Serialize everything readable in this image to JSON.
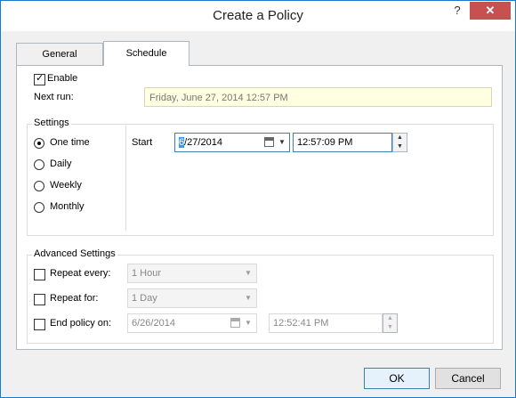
{
  "window": {
    "title": "Create a Policy",
    "help_glyph": "?",
    "close_glyph": "✕"
  },
  "tabs": [
    {
      "label": "General",
      "active": false
    },
    {
      "label": "Schedule",
      "active": true
    }
  ],
  "schedule": {
    "enable_label": "Enable",
    "enable_checked": true,
    "next_run_label": "Next run:",
    "next_run_value": "Friday, June 27, 2014 12:57 PM"
  },
  "settings": {
    "group_label": "Settings",
    "options": [
      {
        "label": "One time",
        "selected": true
      },
      {
        "label": "Daily",
        "selected": false
      },
      {
        "label": "Weekly",
        "selected": false
      },
      {
        "label": "Monthly",
        "selected": false
      }
    ],
    "start_label": "Start",
    "start_date_selected": "6",
    "start_date_rest": "/27/2014",
    "start_time": "12:57:09 PM"
  },
  "advanced": {
    "group_label": "Advanced Settings",
    "repeat_every_label": "Repeat every:",
    "repeat_every_value": "1 Hour",
    "repeat_for_label": "Repeat for:",
    "repeat_for_value": "1 Day",
    "end_policy_label": "End policy on:",
    "end_date": "6/26/2014",
    "end_time": "12:52:41 PM"
  },
  "buttons": {
    "ok": "OK",
    "cancel": "Cancel"
  },
  "icons": {
    "dropdown": "▼",
    "spin_up": "▲",
    "spin_down": "▼"
  }
}
